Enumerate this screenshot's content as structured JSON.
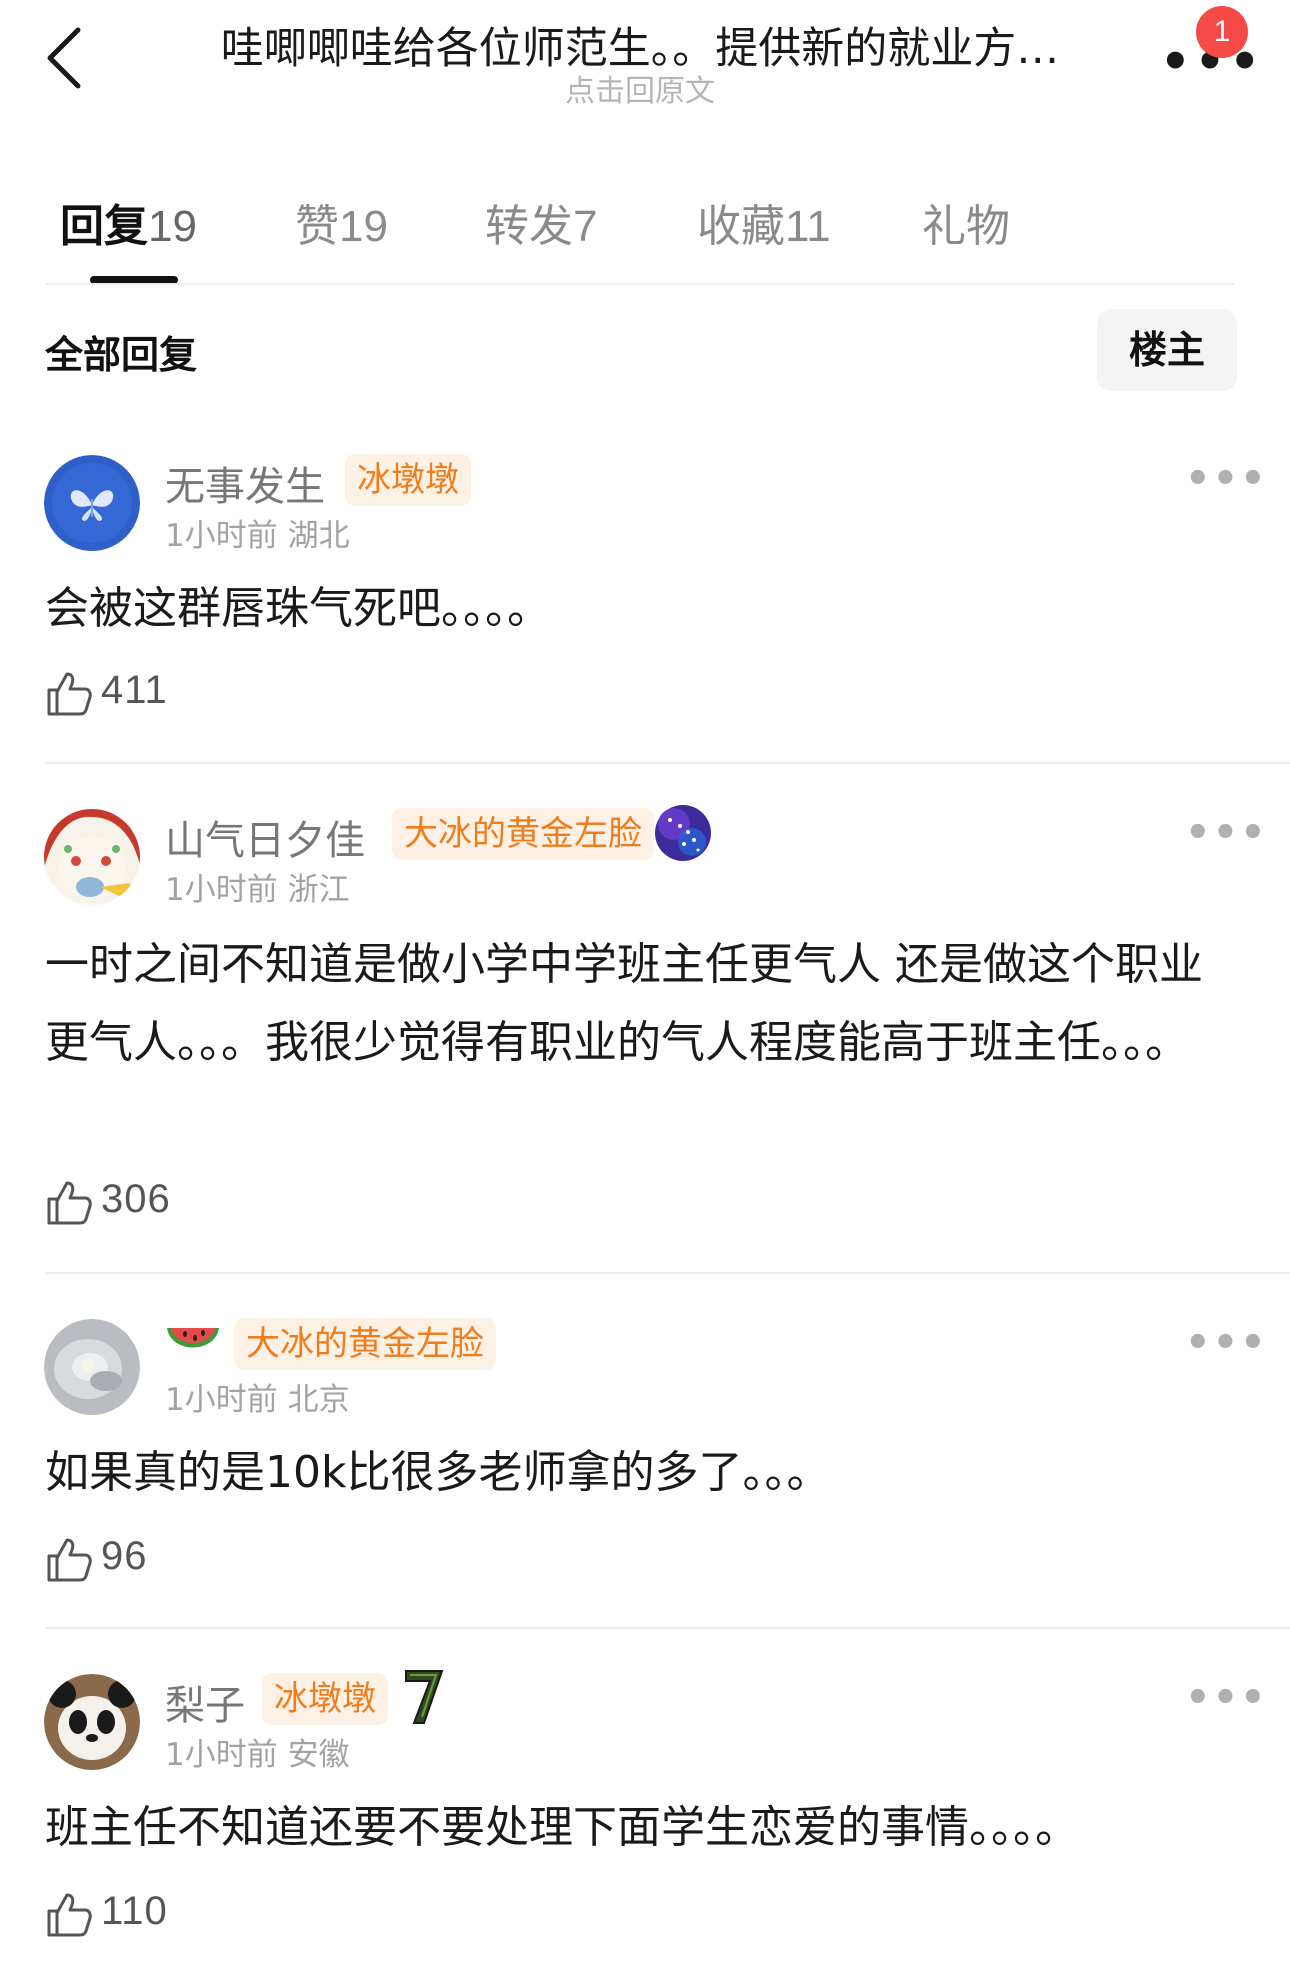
{
  "header": {
    "title": "哇唧唧哇给各位师范生。。提供新的就业方…",
    "subtitle": "点击回原文",
    "notification_count": "1",
    "more_label": "•••"
  },
  "tabs": [
    {
      "label": "回复",
      "count": "19",
      "active": true
    },
    {
      "label": "赞",
      "count": "19"
    },
    {
      "label": "转发",
      "count": "7"
    },
    {
      "label": "收藏",
      "count": "11"
    },
    {
      "label": "礼物",
      "count": ""
    }
  ],
  "filter": {
    "all_replies_label": "全部回复",
    "op_only_label": "楼主"
  },
  "comments": [
    {
      "username": "无事发生",
      "fan_tag": "冰墩墩",
      "time": "1小时前",
      "location": "湖北",
      "text": "会被这群唇珠气死吧。。。。",
      "likes": "411",
      "more": "•••"
    },
    {
      "username": "山气日夕佳",
      "fan_tag": "大冰的黄金左脸",
      "time": "1小时前",
      "location": "浙江",
      "text": "一时之间不知道是做小学中学班主任更气人 还是做这个职业更气人。。。我很少觉得有职业的气人程度能高于班主任。。。",
      "likes": "306",
      "more": "•••"
    },
    {
      "username": "",
      "name_icon": "watermelon-icon",
      "fan_tag": "大冰的黄金左脸",
      "time": "1小时前",
      "location": "北京",
      "text": "如果真的是10k比很多老师拿的多了。。。",
      "likes": "96",
      "more": "•••"
    },
    {
      "username": "梨子",
      "fan_tag": "冰墩墩",
      "time": "1小时前",
      "location": "安徽",
      "text": "班主任不知道还要不要处理下面学生恋爱的事情。。。。",
      "likes": "110",
      "more": "•••"
    }
  ],
  "colors": {
    "tag_text": "#f07c1c",
    "tag_bg": "#fdf1e6",
    "badge": "#f54a45",
    "muted": "#a3a3a3"
  }
}
